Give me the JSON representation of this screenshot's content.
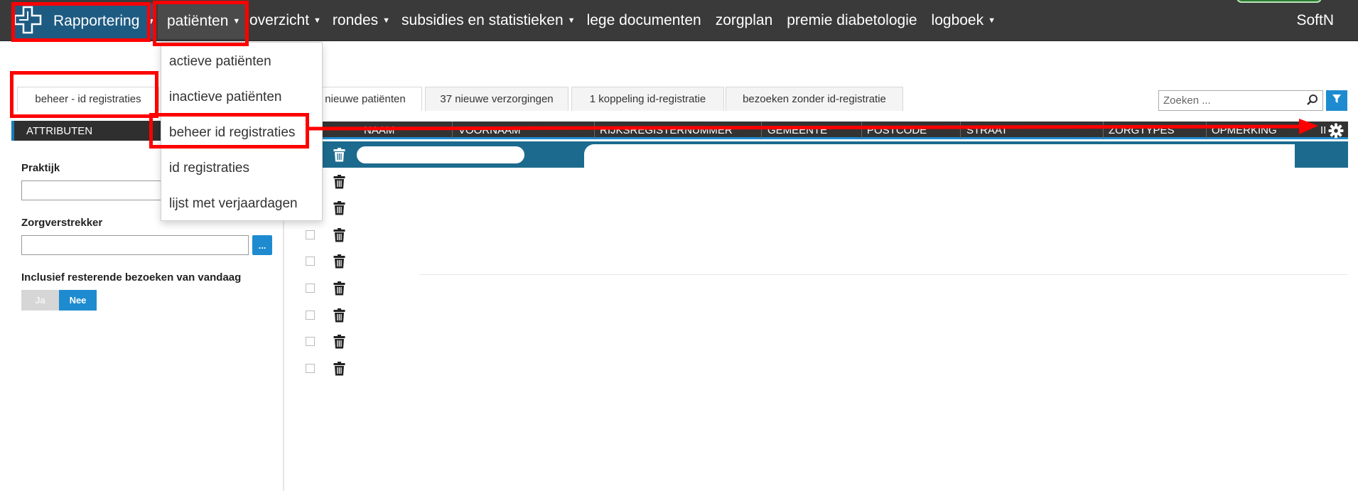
{
  "nav": {
    "brand_label": "Rapportering",
    "patienten_label": "patiënten",
    "items": [
      {
        "label": "overzicht",
        "has_caret": true
      },
      {
        "label": "rondes",
        "has_caret": true
      },
      {
        "label": "subsidies en statistieken",
        "has_caret": true
      },
      {
        "label": "lege documenten",
        "has_caret": false
      },
      {
        "label": "zorgplan",
        "has_caret": false
      },
      {
        "label": "premie diabetologie",
        "has_caret": false
      },
      {
        "label": "logboek",
        "has_caret": true
      }
    ],
    "user_label": "SoftN"
  },
  "dropdown": {
    "items": [
      "actieve patiënten",
      "inactieve patiënten",
      "beheer id registraties",
      "id registraties",
      "lijst met verjaardagen"
    ]
  },
  "left": {
    "tab_label": "beheer - id registraties",
    "panel_title": "ATTRIBUTEN",
    "praktijk_label": "Praktijk",
    "zorgverstrekker_label": "Zorgverstrekker",
    "dots_label": "...",
    "inclusief_label": "Inclusief resterende bezoeken van vandaag",
    "toggle_ja": "Ja",
    "toggle_nee": "Nee"
  },
  "tabs": [
    {
      "label": "nieuwe patiënten",
      "active": true
    },
    {
      "label": "37 nieuwe verzorgingen",
      "active": false
    },
    {
      "label": "1 koppeling id-registratie",
      "active": false
    },
    {
      "label": "bezoeken zonder id-registratie",
      "active": false
    }
  ],
  "search": {
    "placeholder": "Zoeken ..."
  },
  "table": {
    "columns": [
      "NAAM",
      "VOORNAAM",
      "RIJKSREGISTERNUMMER",
      "GEMEENTE",
      "POSTCODE",
      "STRAAT",
      "ZORGTYPES",
      "OPMERKING"
    ],
    "row_count": 9
  },
  "colors": {
    "nav_bg": "#3a3a3a",
    "brand_bg": "#1e5b82",
    "accent": "#1e8bd0",
    "highlight_row": "#1c6b8e",
    "annotation": "#ff0000"
  }
}
